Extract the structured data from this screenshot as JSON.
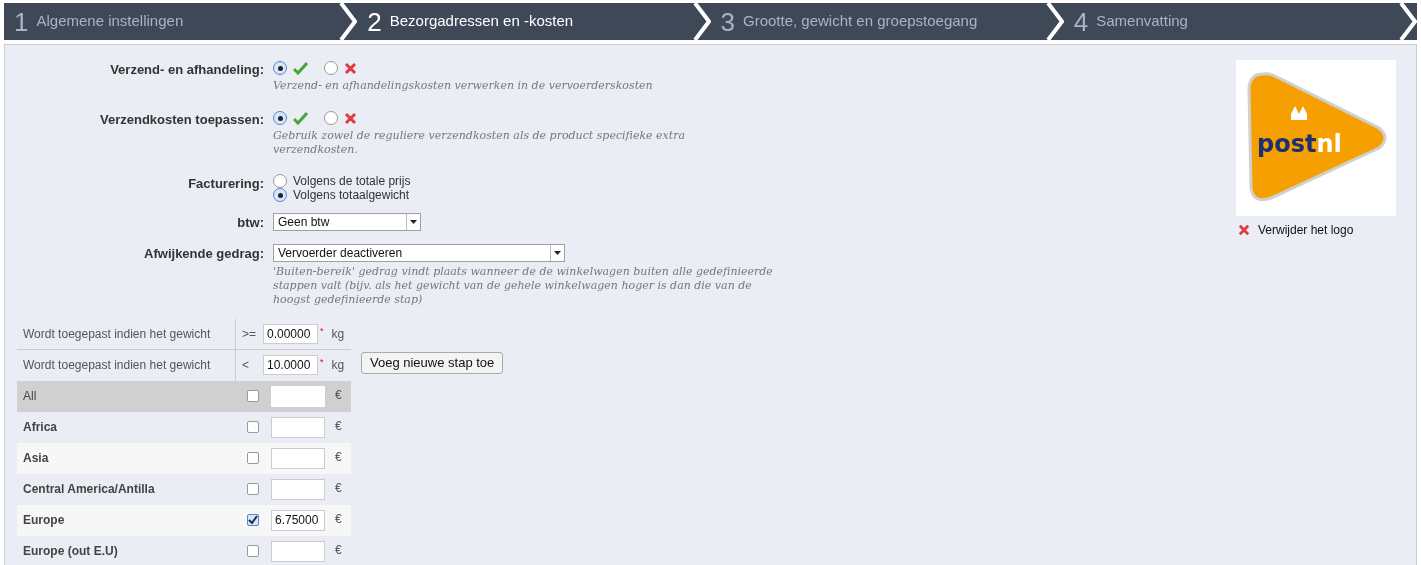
{
  "steps": [
    {
      "number": "1",
      "label": "Algemene instellingen",
      "selected": false
    },
    {
      "number": "2",
      "label": "Bezorgadressen en -kosten",
      "selected": true
    },
    {
      "number": "3",
      "label": "Grootte, gewicht en groepstoegang",
      "selected": false
    },
    {
      "number": "4",
      "label": "Samenvatting",
      "selected": false
    }
  ],
  "form": [
    {
      "kind": "yesno",
      "label": "Verzend- en afhandeling:",
      "yes": true,
      "help": "Verzend- en afhandelingskosten verwerken in de vervoerderskosten"
    },
    {
      "kind": "yesno",
      "label": "Verzendkosten toepassen:",
      "yes": true,
      "help": "Gebruik zowel de reguliere verzendkosten als de product specifieke extra verzendkosten."
    },
    {
      "kind": "radio",
      "label": "Facturering:",
      "options": [
        {
          "label": "Volgens de totale prijs",
          "selected": false
        },
        {
          "label": "Volgens totaalgewicht",
          "selected": true
        }
      ]
    },
    {
      "kind": "select",
      "label": "btw:",
      "value": "Geen btw"
    },
    {
      "kind": "select",
      "label": "Afwijkende gedrag:",
      "value": "Vervoerder deactiveren",
      "help": "'Buiten-bereik' gedrag vindt plaats wanneer de de winkelwagen buiten alle gedefinieerde stappen valt (bijv. als het gewicht van de gehele winkelwagen hoger is dan die van de hoogst gedefinieerde stap)"
    }
  ],
  "range": [
    {
      "label": "Wordt toegepast indien het gewicht",
      "operator": ">=",
      "value": "0.00000",
      "required_mark": "*",
      "unit": "kg"
    },
    {
      "label": "Wordt toegepast indien het gewicht",
      "operator": "<",
      "value": "10.0000",
      "required_mark": "*",
      "unit": "kg"
    }
  ],
  "add_button": "Voeg nieuwe stap toe",
  "zones": [
    {
      "kind": "all",
      "name": "All",
      "checked": false,
      "currency": "€"
    },
    {
      "kind": "zone",
      "name": "Africa",
      "checked": false,
      "currency": "€"
    },
    {
      "kind": "zone",
      "name": "Asia",
      "checked": false,
      "currency": "€"
    },
    {
      "kind": "zone",
      "name": "Central America/Antilla",
      "checked": false,
      "currency": "€"
    },
    {
      "kind": "zone",
      "name": "Europe",
      "checked": true,
      "price": "6.75000",
      "currency": "€"
    },
    {
      "kind": "zone",
      "name": "Europe (out E.U)",
      "checked": false,
      "currency": "€"
    }
  ],
  "logo": {
    "text_dark": "post",
    "text_light": "nl"
  },
  "remove_logo": "Verwijder het logo"
}
